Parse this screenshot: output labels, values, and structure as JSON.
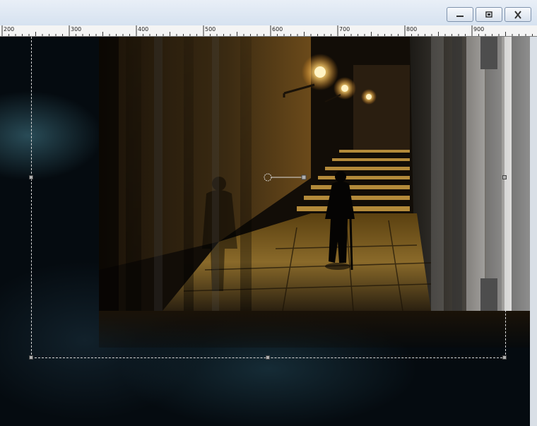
{
  "window": {
    "buttons": [
      {
        "name": "minimize",
        "icon": "minimize-icon"
      },
      {
        "name": "restore",
        "icon": "restore-icon"
      },
      {
        "name": "close",
        "icon": "close-icon"
      }
    ]
  },
  "ruler": {
    "labels": [
      "200",
      "300",
      "400",
      "500",
      "600",
      "700",
      "800",
      "900"
    ]
  },
  "canvas": {
    "image": "night-alley-photo",
    "colors": {
      "background": "#050b10",
      "glow": "#3c6e7d",
      "lamp": "#ffd27a"
    }
  }
}
